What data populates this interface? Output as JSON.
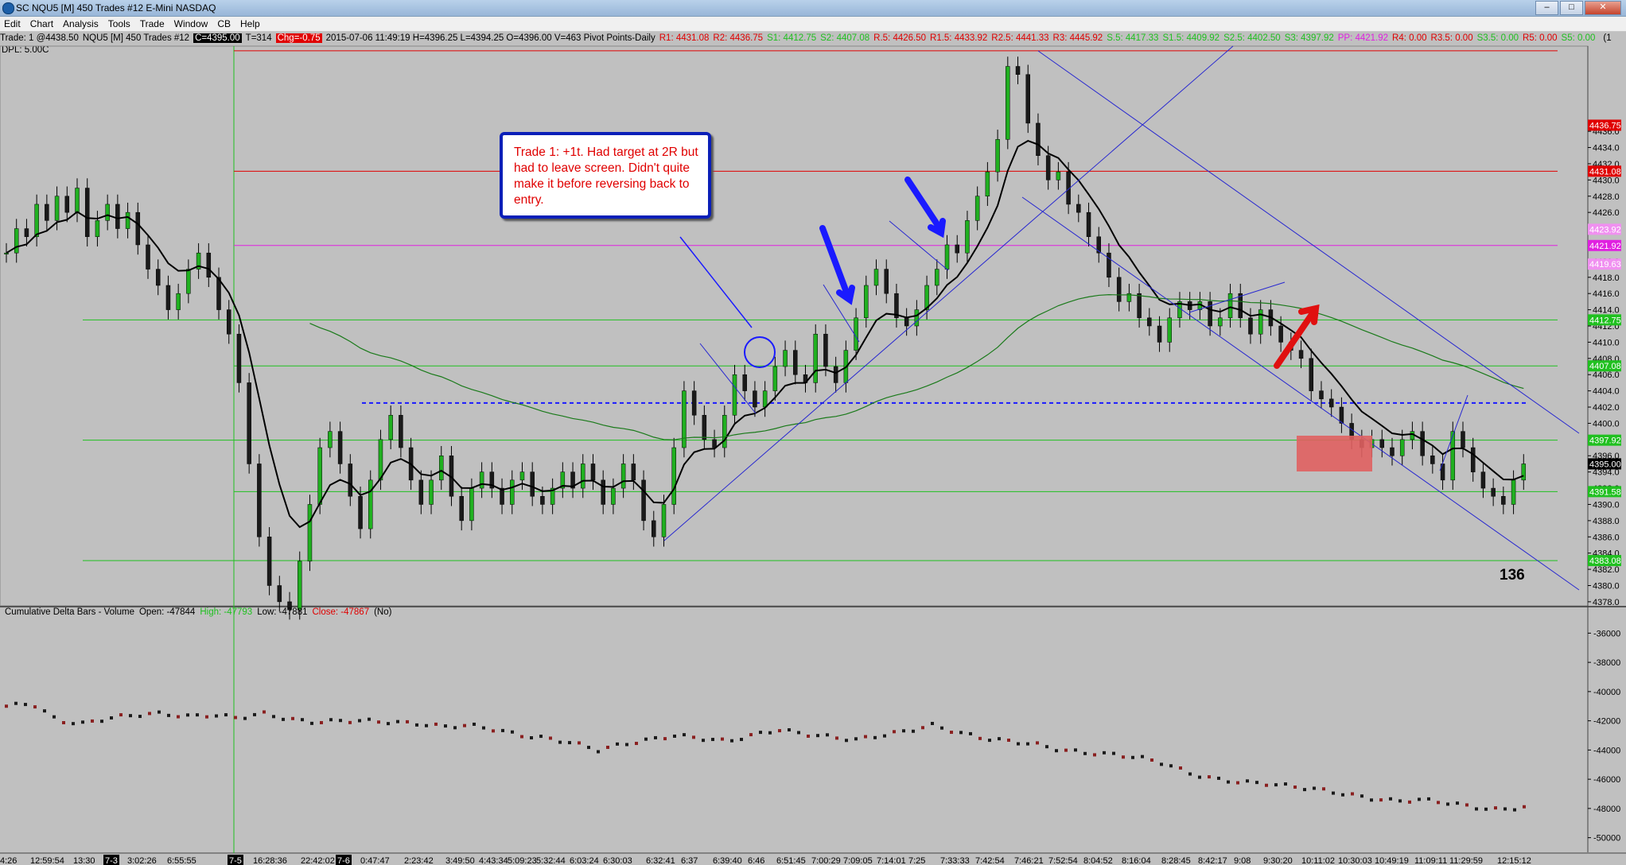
{
  "window": {
    "title": "SC NQU5 [M]  450 Trades  #12  E-Mini NASDAQ"
  },
  "menu": [
    "Edit",
    "Chart",
    "Analysis",
    "Tools",
    "Trade",
    "Window",
    "CB",
    "Help"
  ],
  "header": {
    "trade": "Trade: 1 @4438.50",
    "symbol": "NQU5 [M]  450 Trades  #12",
    "close": "C=4395.00",
    "t": "T=314",
    "chg": "Chg=-0.75",
    "stamp": "2015-07-06 11:49:19 H=4396.25 L=4394.25 O=4396.00 V=463 Pivot Points-Daily",
    "pivots": [
      {
        "t": "R1: 4431.08",
        "c": "#e00000"
      },
      {
        "t": "R2: 4436.75",
        "c": "#e00000"
      },
      {
        "t": "S1: 4412.75",
        "c": "#20c020"
      },
      {
        "t": "S2: 4407.08",
        "c": "#20c020"
      },
      {
        "t": "R.5: 4426.50",
        "c": "#e00000"
      },
      {
        "t": "R1.5: 4433.92",
        "c": "#e00000"
      },
      {
        "t": "R2.5: 4441.33",
        "c": "#e00000"
      },
      {
        "t": "R3: 4445.92",
        "c": "#e00000"
      },
      {
        "t": "S.5: 4417.33",
        "c": "#20c020"
      },
      {
        "t": "S1.5: 4409.92",
        "c": "#20c020"
      },
      {
        "t": "S2.5: 4402.50",
        "c": "#20c020"
      },
      {
        "t": "S3: 4397.92",
        "c": "#20c020"
      },
      {
        "t": "PP: 4421.92",
        "c": "#e020e0"
      },
      {
        "t": "R4: 0.00",
        "c": "#e00000"
      },
      {
        "t": "R3.5: 0.00",
        "c": "#e00000"
      },
      {
        "t": "S3.5: 0.00",
        "c": "#20c020"
      },
      {
        "t": "R5: 0.00",
        "c": "#e00000"
      },
      {
        "t": "S5: 0.00",
        "c": "#20c020"
      }
    ],
    "tail": "(1"
  },
  "dpl": "DPL: 5.00C",
  "annotation": {
    "text": "Trade 1: +1t.  Had target at 2R but had to leave screen.  Didn't quite make it before reversing back to entry.",
    "trade_count": "136"
  },
  "indicator": {
    "name": "Cumulative Delta Bars - Volume",
    "open": "Open: -47844",
    "high": "High: -47793",
    "low": "Low: -47881",
    "close": "Close: -47867",
    "tail": "(No)"
  },
  "colors": {
    "pivot_red": "#e00000",
    "pivot_green": "#20c020",
    "pivot_pink": "#e020e0",
    "trendline": "#2828d0",
    "bg": "#c0c0c0"
  },
  "chart_data": [
    {
      "type": "candlestick",
      "title": "",
      "y_ticks": [
        4436,
        4434,
        4432,
        4430,
        4428,
        4426,
        4424,
        4422,
        4420,
        4418,
        4416,
        4414,
        4412,
        4410,
        4408,
        4406,
        4404,
        4402,
        4400,
        4398,
        4396,
        4394,
        4392,
        4390,
        4388,
        4386,
        4384,
        4382,
        4380,
        4378
      ],
      "ylim": [
        4377.5,
        4446.5
      ],
      "price_tags": [
        {
          "label": "4436.75",
          "value": 4436.75,
          "bg": "#e00000",
          "fg": "#ffffff"
        },
        {
          "label": "4431.08",
          "value": 4431.08,
          "bg": "#e00000",
          "fg": "#ffffff"
        },
        {
          "label": "4421.92",
          "value": 4421.92,
          "bg": "#e020e0",
          "fg": "#ffffff"
        },
        {
          "label": "4419.63",
          "value": 4419.63,
          "bg": "#f090f0",
          "fg": "#ffffff"
        },
        {
          "label": "4423.92",
          "value": 4423.92,
          "bg": "#f090f0",
          "fg": "#ffffff"
        },
        {
          "label": "4412.75",
          "value": 4412.75,
          "bg": "#20c020",
          "fg": "#ffffff"
        },
        {
          "label": "4407.08",
          "value": 4407.08,
          "bg": "#20c020",
          "fg": "#ffffff"
        },
        {
          "label": "4397.92",
          "value": 4397.92,
          "bg": "#20c020",
          "fg": "#ffffff"
        },
        {
          "label": "4395.00",
          "value": 4395.0,
          "bg": "#000000",
          "fg": "#ffffff"
        },
        {
          "label": "4391.58",
          "value": 4391.58,
          "bg": "#20c020",
          "fg": "#ffffff"
        },
        {
          "label": "4383.08",
          "value": 4383.08,
          "bg": "#20c020",
          "fg": "#ffffff"
        }
      ],
      "levels": [
        {
          "value": 4445.92,
          "color": "#e00000"
        },
        {
          "value": 4431.08,
          "color": "#e00000"
        },
        {
          "value": 4421.92,
          "color": "#e020e0"
        },
        {
          "value": 4412.75,
          "color": "#20c020"
        },
        {
          "value": 4407.08,
          "color": "#20c020"
        },
        {
          "value": 4397.92,
          "color": "#20c020"
        },
        {
          "value": 4391.58,
          "color": "#20c020"
        },
        {
          "value": 4383.08,
          "color": "#20c020"
        }
      ],
      "dashed_level": 4402.5,
      "close_series": [
        4421,
        4424,
        4423,
        4427,
        4425,
        4428,
        4426,
        4429,
        4423,
        4425,
        4427,
        4424,
        4426,
        4422,
        4419,
        4417,
        4414,
        4416,
        4419,
        4421,
        4418,
        4414,
        4411,
        4405,
        4395,
        4386,
        4380,
        4378,
        4377,
        4383,
        4390,
        4397,
        4399,
        4395,
        4391,
        4387,
        4393,
        4398,
        4401,
        4397,
        4393,
        4390,
        4393,
        4396,
        4391,
        4388,
        4392,
        4394,
        4392,
        4390,
        4393,
        4394,
        4391,
        4390,
        4392,
        4394,
        4392,
        4395,
        4393,
        4390,
        4392,
        4395,
        4393,
        4388,
        4386,
        4390,
        4397,
        4404,
        4401,
        4398,
        4397,
        4401,
        4406,
        4404,
        4402,
        4404,
        4407,
        4409,
        4406,
        4405,
        4411,
        4407,
        4405,
        4409,
        4413,
        4417,
        4419,
        4416,
        4413,
        4412,
        4414,
        4417,
        4419,
        4422,
        4421,
        4425,
        4428,
        4431,
        4435,
        4444,
        4443,
        4437,
        4433,
        4430,
        4431,
        4427,
        4426,
        4423,
        4421,
        4418,
        4415,
        4416,
        4413,
        4412,
        4410,
        4413,
        4415,
        4414,
        4415,
        4412,
        4413,
        4416,
        4413,
        4411,
        4414,
        4412,
        4410,
        4409,
        4408,
        4404,
        4403,
        4402,
        4400,
        4398,
        4397,
        4398,
        4397,
        4396,
        4398,
        4399,
        4396,
        4395,
        4393,
        4399,
        4397,
        4394,
        4392,
        4391,
        4390,
        4393,
        4395
      ],
      "x_labels": [
        "4:26",
        "12:59:54",
        "13:30",
        "7-3",
        "3:02:26",
        "6:55:55",
        "7-5",
        "16:28:36",
        "22:42:02",
        "7-6",
        "0:47:47",
        "2:23:42",
        "3:49:50",
        "4:43:34",
        "5:09:23",
        "5:32:44",
        "6:03:24",
        "6:30:03",
        "6:32:41",
        "6:37",
        "6:39:40",
        "6:46",
        "6:51:45",
        "7:00:29",
        "7:09:05",
        "7:14:01",
        "7:25",
        "7:33:33",
        "7:42:54",
        "7:46:21",
        "7:52:54",
        "8:04:52",
        "8:16:04",
        "8:28:45",
        "8:42:17",
        "9:08",
        "9:30:20",
        "10:11:02",
        "10:30:03",
        "10:49:19",
        "11:09:11",
        "11:29:59",
        "12:15:12"
      ]
    },
    {
      "type": "line",
      "title": "",
      "y_ticks": [
        -36000,
        -38000,
        -40000,
        -42000,
        -44000,
        -46000,
        -48000,
        -50000
      ],
      "ylim": [
        -51000,
        -35000
      ],
      "values": [
        -41000,
        -40800,
        -42000,
        -42200,
        -41800,
        -41600,
        -41500,
        -41700,
        -41600,
        -41800,
        -41500,
        -41900,
        -42100,
        -42000,
        -42000,
        -42100,
        -42200,
        -42400,
        -42300,
        -42600,
        -43000,
        -43200,
        -43500,
        -44000,
        -43600,
        -43300,
        -43000,
        -43200,
        -43400,
        -43000,
        -42600,
        -42900,
        -43100,
        -43300,
        -43000,
        -42700,
        -42300,
        -42800,
        -43200,
        -43400,
        -43600,
        -44000,
        -44200,
        -44300,
        -44500,
        -44900,
        -45600,
        -46000,
        -46200,
        -46300,
        -46500,
        -46700,
        -47000,
        -47300,
        -47500,
        -47400,
        -47600,
        -47900,
        -48100,
        -47900
      ]
    }
  ]
}
